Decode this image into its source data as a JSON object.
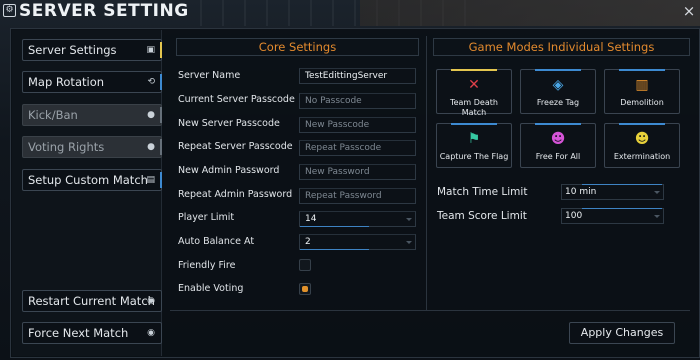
{
  "window": {
    "title": "SERVER SETTING",
    "title_icon": "window-settings-icon",
    "close_glyph": "×"
  },
  "sidebar": {
    "items": [
      {
        "label": "Server Settings",
        "icon": "server-icon",
        "icon_glyph": "▣",
        "state": "active"
      },
      {
        "label": "Map Rotation",
        "icon": "map-rotation-icon",
        "icon_glyph": "⟲",
        "state": "normal"
      },
      {
        "label": "Kick/Ban",
        "icon": "user-icon",
        "icon_glyph": "●",
        "state": "disabled"
      },
      {
        "label": "Voting Rights",
        "icon": "user-icon",
        "icon_glyph": "●",
        "state": "disabled"
      },
      {
        "label": "Setup Custom Match",
        "icon": "custom-match-icon",
        "icon_glyph": "▤",
        "state": "normal"
      }
    ],
    "bottom_buttons": [
      {
        "label": "Restart Current Match",
        "icon": "restart-icon",
        "icon_glyph": "◉"
      },
      {
        "label": "Force Next Match",
        "icon": "next-icon",
        "icon_glyph": "◉"
      }
    ]
  },
  "core": {
    "heading": "Core Settings",
    "server_name": {
      "label": "Server Name",
      "value": "TestEdittingServer"
    },
    "current_passcode": {
      "label": "Current Server Passcode",
      "placeholder": "No Passcode"
    },
    "new_passcode": {
      "label": "New Server Passcode",
      "placeholder": "New Passcode"
    },
    "repeat_passcode": {
      "label": "Repeat Server Passcode",
      "placeholder": "Repeat Passcode"
    },
    "new_admin_password": {
      "label": "New Admin Password",
      "placeholder": "New Password"
    },
    "repeat_admin_password": {
      "label": "Repeat Admin Password",
      "placeholder": "Repeat Password"
    },
    "player_limit": {
      "label": "Player Limit",
      "value": "14"
    },
    "auto_balance": {
      "label": "Auto Balance At",
      "value": "2"
    },
    "friendly_fire": {
      "label": "Friendly Fire",
      "checked": false
    },
    "enable_voting": {
      "label": "Enable Voting",
      "checked": true
    }
  },
  "game_modes": {
    "heading": "Game Modes Individual Settings",
    "modes": [
      {
        "label": "Team Death Match",
        "icon": "crossed-guns-icon",
        "glyph": "✕",
        "color": "#e0404a"
      },
      {
        "label": "Freeze Tag",
        "icon": "ice-cube-icon",
        "glyph": "◈",
        "color": "#4aa8e8"
      },
      {
        "label": "Demolition",
        "icon": "dynamite-icon",
        "glyph": "▥",
        "color": "#e8942e"
      },
      {
        "label": "Capture The Flag",
        "icon": "flag-runner-icon",
        "glyph": "⚑",
        "color": "#36c9a3"
      },
      {
        "label": "Free For All",
        "icon": "skull-icon",
        "glyph": "☻",
        "color": "#d654d8"
      },
      {
        "label": "Extermination",
        "icon": "skull-icon",
        "glyph": "☻",
        "color": "#e8d13a"
      }
    ],
    "match_time_limit": {
      "label": "Match Time Limit",
      "value": "10 min"
    },
    "team_score_limit": {
      "label": "Team Score Limit",
      "value": "100"
    }
  },
  "footer": {
    "apply_label": "Apply Changes"
  }
}
